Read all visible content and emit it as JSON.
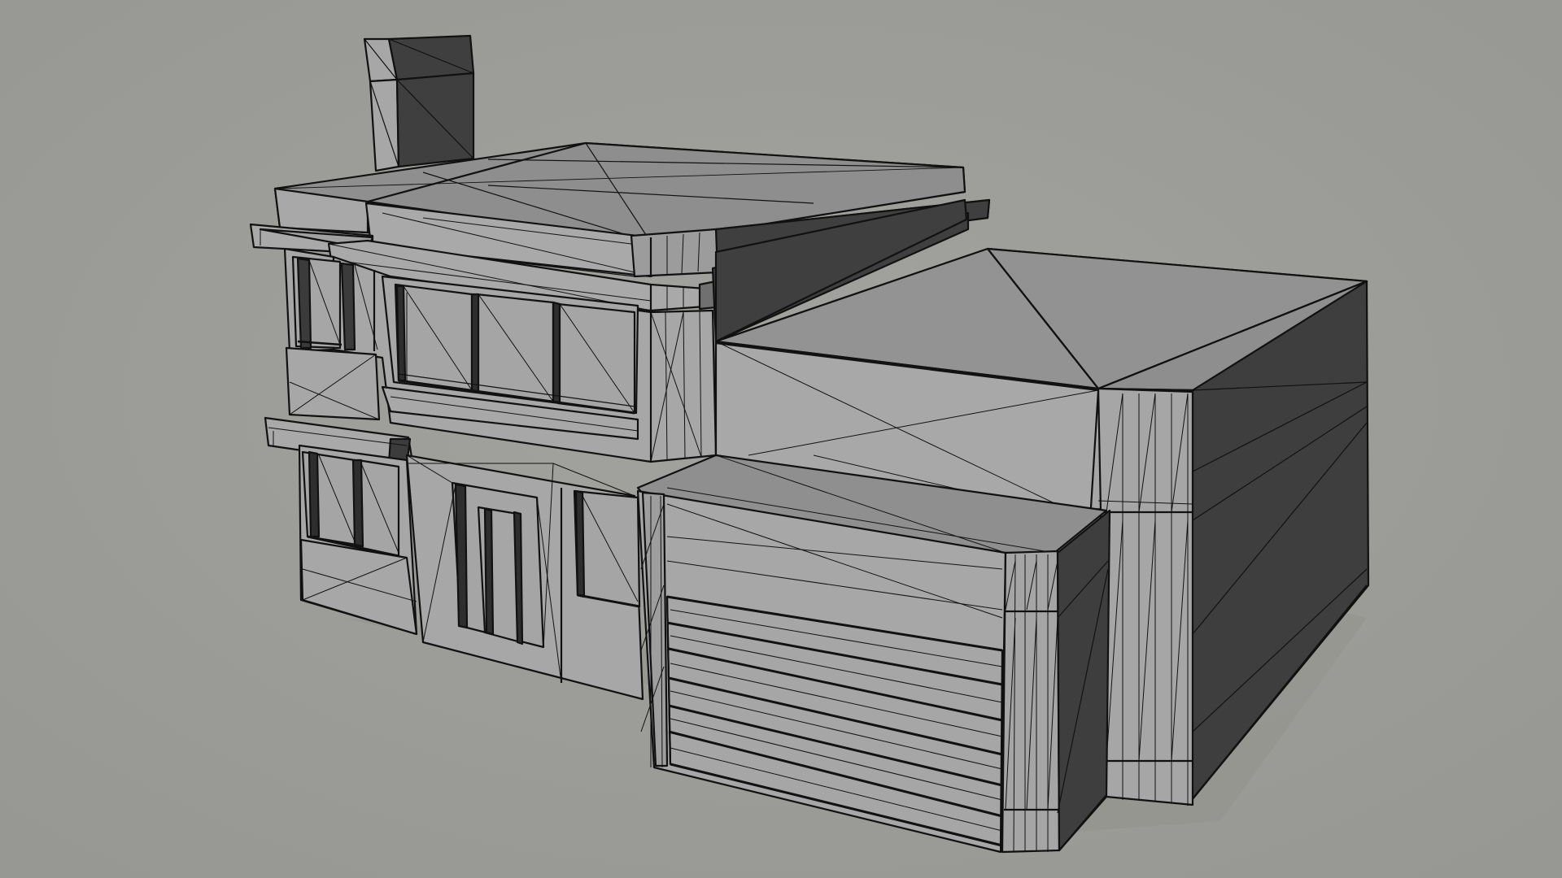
{
  "scene": {
    "subject": "wireframe-house-model",
    "background_color": "#9c9c98",
    "shading": {
      "lit_face": "#a4a4a4",
      "top_face": "#8f8f8f",
      "shadow_face": "#3e3e3f",
      "wire": "#111111"
    }
  }
}
